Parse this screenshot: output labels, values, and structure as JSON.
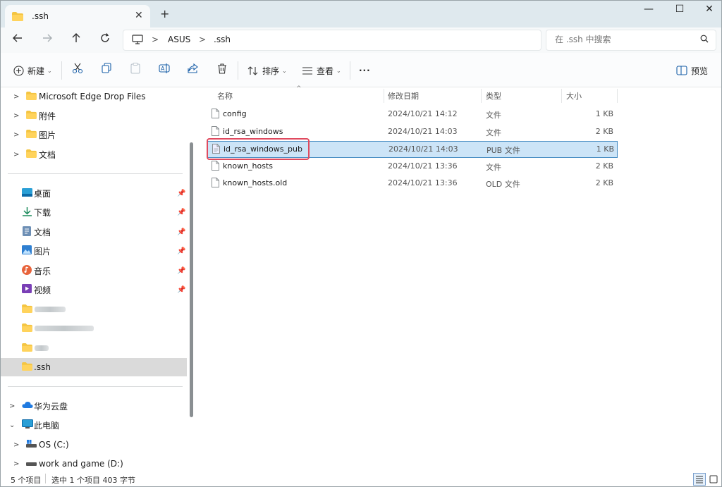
{
  "tab": {
    "title": ".ssh",
    "close": "✕",
    "new_tab": "+"
  },
  "window_controls": {
    "minimize": "—",
    "maximize": "☐",
    "close": "✕"
  },
  "address": {
    "crumbs": [
      "ASUS",
      ".ssh"
    ],
    "separator": ">"
  },
  "search": {
    "placeholder": "在 .ssh 中搜索"
  },
  "toolbar": {
    "new_label": "新建",
    "sort_label": "排序",
    "view_label": "查看",
    "more_label": "···",
    "preview_label": "预览"
  },
  "nav": {
    "top_items": [
      {
        "label": "Microsoft Edge Drop Files"
      },
      {
        "label": "附件"
      },
      {
        "label": "图片"
      },
      {
        "label": "文档"
      }
    ],
    "quick_access": [
      {
        "label": "桌面",
        "icon": "desktop-icon"
      },
      {
        "label": "下载",
        "icon": "download-icon"
      },
      {
        "label": "文档",
        "icon": "document-icon"
      },
      {
        "label": "图片",
        "icon": "picture-icon"
      },
      {
        "label": "音乐",
        "icon": "music-icon"
      },
      {
        "label": "视频",
        "icon": "video-icon"
      }
    ],
    "selected_folder": ".ssh",
    "bottom_items": [
      {
        "label": "华为云盘",
        "icon": "cloud-icon"
      },
      {
        "label": "此电脑",
        "icon": "pc-icon"
      },
      {
        "label": "OS (C:)",
        "icon": "drive-icon"
      },
      {
        "label": "work and game  (D:)",
        "icon": "drive-icon"
      }
    ]
  },
  "columns": {
    "name": "名称",
    "date": "修改日期",
    "type": "类型",
    "size": "大小"
  },
  "files": [
    {
      "name": "config",
      "date": "2024/10/21 14:12",
      "type": "文件",
      "size": "1 KB"
    },
    {
      "name": "id_rsa_windows",
      "date": "2024/10/21 14:03",
      "type": "文件",
      "size": "2 KB"
    },
    {
      "name": "id_rsa_windows_pub",
      "date": "2024/10/21 14:03",
      "type": "PUB 文件",
      "size": "1 KB"
    },
    {
      "name": "known_hosts",
      "date": "2024/10/21 13:36",
      "type": "文件",
      "size": "2 KB"
    },
    {
      "name": "known_hosts.old",
      "date": "2024/10/21 13:36",
      "type": "OLD 文件",
      "size": "2 KB"
    }
  ],
  "status": {
    "count": "5 个项目",
    "selection": "选中 1 个项目  403 字节"
  },
  "colors": {
    "accent": "#0067c0",
    "selection": "#cce4f7",
    "highlight": "#e04a5f",
    "folder": "#f4c542"
  }
}
